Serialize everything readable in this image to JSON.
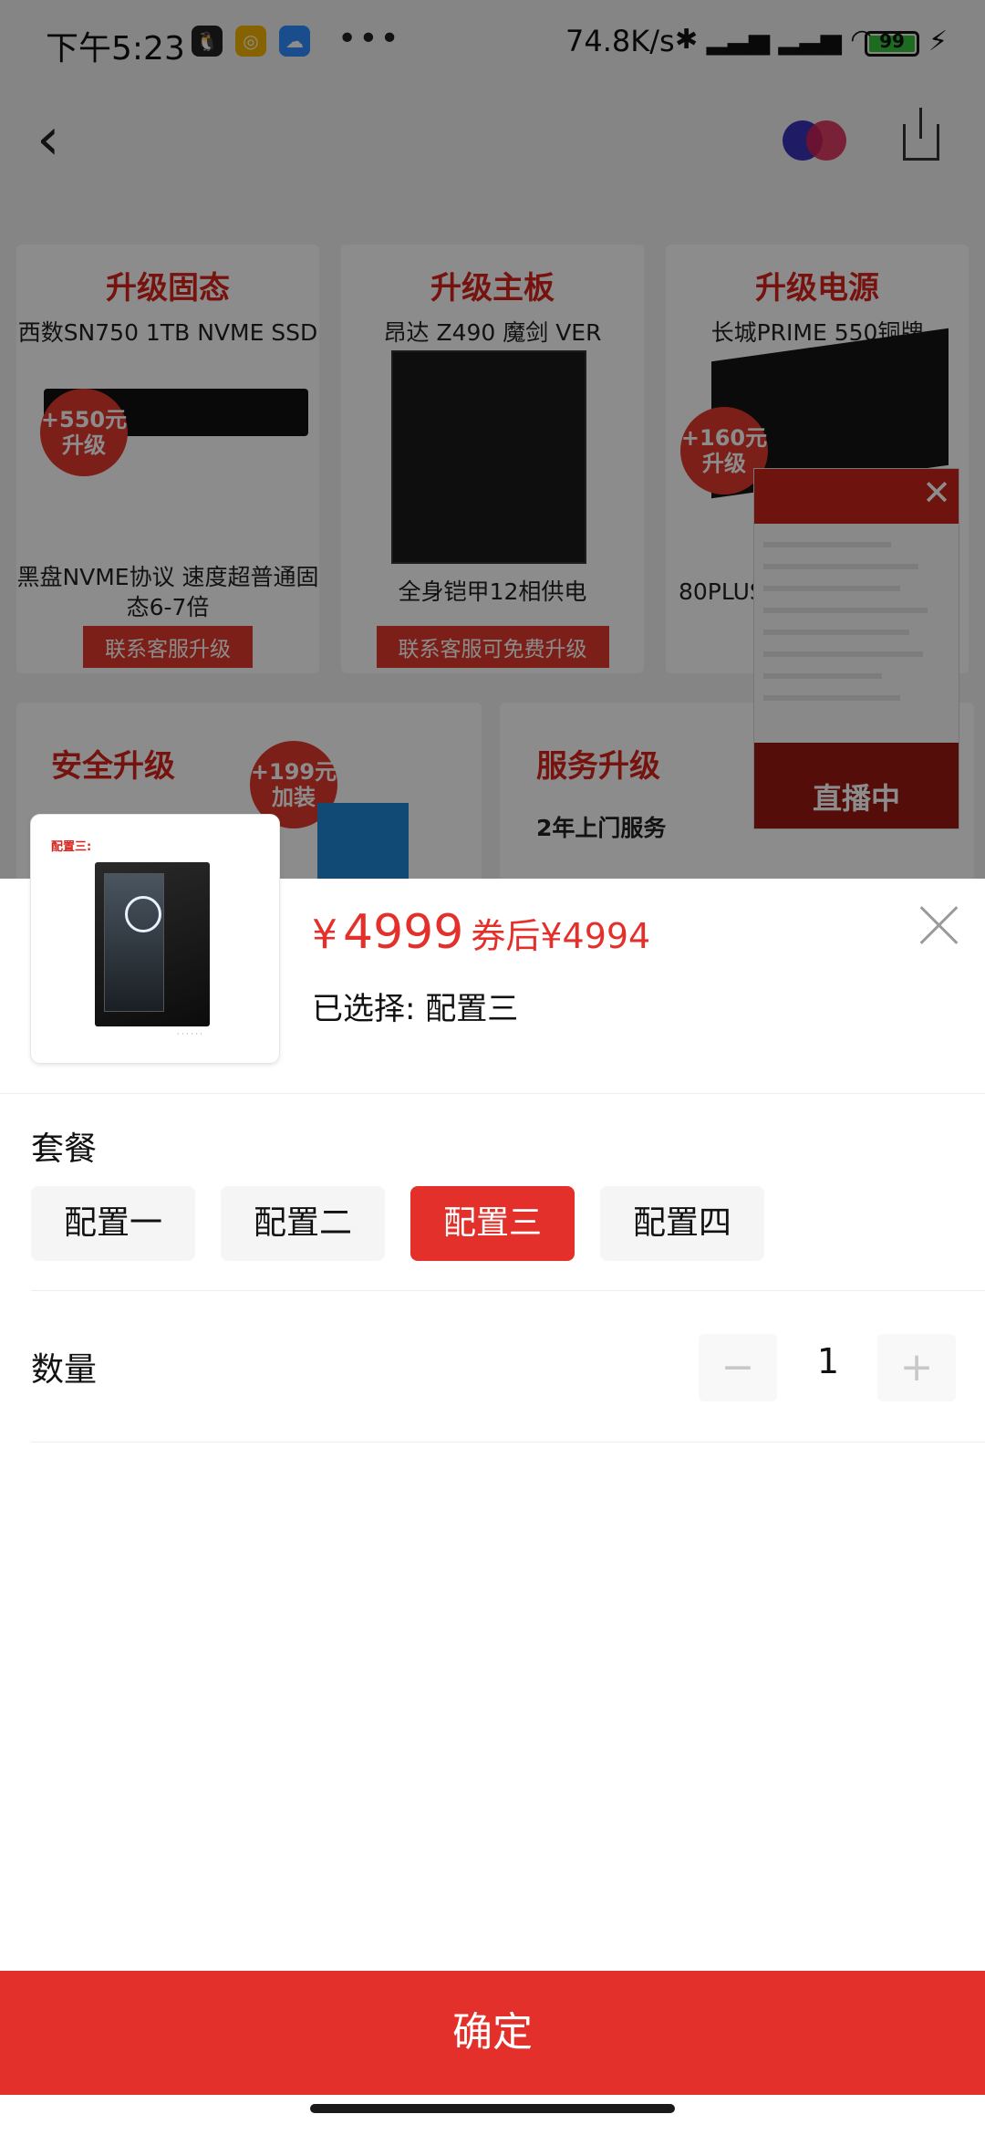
{
  "status_bar": {
    "time": "下午5:23",
    "apps": [
      "qq-icon",
      "weibo-icon",
      "messenger-icon"
    ],
    "more": "•••",
    "speed": "74.8K/s",
    "battery": "99",
    "battery_level": 0.99
  },
  "background_page": {
    "cards": [
      {
        "title": "升级固态",
        "subtitle": "西数SN750 1TB NVME SSD",
        "badge": "+550元 升级",
        "desc": "黑盘NVME协议 速度超普通固态6-7倍",
        "link": "联系客服升级"
      },
      {
        "title": "升级主板",
        "subtitle": "昂达 Z490 魔剑 VER",
        "desc": "全身铠甲12相供电",
        "link": "联系客服可免费升级"
      },
      {
        "title": "升级电源",
        "subtitle": "长城PRIME 550铜牌",
        "badge": "+160元 升级",
        "desc": "80PLUS"
      },
      {
        "title": "安全升级",
        "badge": "+199元 加装"
      },
      {
        "title": "服务升级",
        "subtitle": "2年上门服务"
      }
    ],
    "live_widget": {
      "label": "直播中"
    }
  },
  "product": {
    "thumb_tag": "配置三:",
    "price_symbol": "¥",
    "price": "4999",
    "coupon_price": "券后¥4994",
    "selected_prefix": "已选择:",
    "selected_value": "配置三"
  },
  "options": {
    "title": "套餐",
    "items": [
      {
        "label": "配置一",
        "selected": false
      },
      {
        "label": "配置二",
        "selected": false
      },
      {
        "label": "配置三",
        "selected": true
      },
      {
        "label": "配置四",
        "selected": false
      }
    ]
  },
  "quantity": {
    "title": "数量",
    "minus": "−",
    "value": "1",
    "plus": "+"
  },
  "confirm_label": "确定",
  "colors": {
    "accent": "#e3302a",
    "promo_red": "#d8231c",
    "option_bg": "#f5f5f5"
  }
}
